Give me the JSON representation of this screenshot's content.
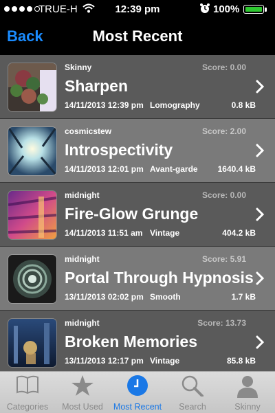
{
  "status_bar": {
    "carrier": "TRUE-H",
    "time": "12:39 pm",
    "battery": "100%",
    "battery_level": 1.0,
    "signal_bars_filled": 4,
    "signal_bars_total": 5
  },
  "nav": {
    "back_label": "Back",
    "title": "Most Recent"
  },
  "items": [
    {
      "author": "Skinny",
      "score": "Score: 0.00",
      "title": "Sharpen",
      "date": "14/11/2013 12:39 pm",
      "filter": "Lomography",
      "size": "0.8 kB"
    },
    {
      "author": "cosmicstew",
      "score": "Score: 2.00",
      "title": "Introspectivity",
      "date": "14/11/2013 12:01 pm",
      "filter": "Avant-garde",
      "size": "1640.4 kB"
    },
    {
      "author": "midnight",
      "score": "Score: 0.00",
      "title": "Fire-Glow Grunge",
      "date": "14/11/2013 11:51 am",
      "filter": "Vintage",
      "size": "404.2 kB"
    },
    {
      "author": "midnight",
      "score": "Score: 5.91",
      "title": "Portal Through Hypnosis",
      "date": "13/11/2013 02:02 pm",
      "filter": "Smooth",
      "size": "1.7 kB"
    },
    {
      "author": "midnight",
      "score": "Score: 13.73",
      "title": "Broken Memories",
      "date": "13/11/2013 12:17 pm",
      "filter": "Vintage",
      "size": "85.8 kB"
    }
  ],
  "tabs": [
    {
      "label": "Categories",
      "icon": "book-icon"
    },
    {
      "label": "Most Used",
      "icon": "star-icon"
    },
    {
      "label": "Most Recent",
      "icon": "clock-icon",
      "active": true
    },
    {
      "label": "Search",
      "icon": "search-icon"
    },
    {
      "label": "Skinny",
      "icon": "user-icon"
    }
  ],
  "colors": {
    "accent": "#1a78e6",
    "back_button": "#1a8cff",
    "battery": "#2ec830"
  }
}
